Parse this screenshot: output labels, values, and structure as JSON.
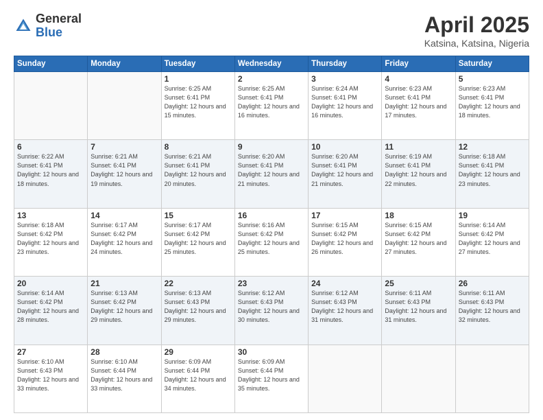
{
  "logo": {
    "general": "General",
    "blue": "Blue"
  },
  "title": {
    "month": "April 2025",
    "location": "Katsina, Katsina, Nigeria"
  },
  "weekdays": [
    "Sunday",
    "Monday",
    "Tuesday",
    "Wednesday",
    "Thursday",
    "Friday",
    "Saturday"
  ],
  "weeks": [
    [
      {
        "day": "",
        "sunrise": "",
        "sunset": "",
        "daylight": ""
      },
      {
        "day": "",
        "sunrise": "",
        "sunset": "",
        "daylight": ""
      },
      {
        "day": "1",
        "sunrise": "Sunrise: 6:25 AM",
        "sunset": "Sunset: 6:41 PM",
        "daylight": "Daylight: 12 hours and 15 minutes."
      },
      {
        "day": "2",
        "sunrise": "Sunrise: 6:25 AM",
        "sunset": "Sunset: 6:41 PM",
        "daylight": "Daylight: 12 hours and 16 minutes."
      },
      {
        "day": "3",
        "sunrise": "Sunrise: 6:24 AM",
        "sunset": "Sunset: 6:41 PM",
        "daylight": "Daylight: 12 hours and 16 minutes."
      },
      {
        "day": "4",
        "sunrise": "Sunrise: 6:23 AM",
        "sunset": "Sunset: 6:41 PM",
        "daylight": "Daylight: 12 hours and 17 minutes."
      },
      {
        "day": "5",
        "sunrise": "Sunrise: 6:23 AM",
        "sunset": "Sunset: 6:41 PM",
        "daylight": "Daylight: 12 hours and 18 minutes."
      }
    ],
    [
      {
        "day": "6",
        "sunrise": "Sunrise: 6:22 AM",
        "sunset": "Sunset: 6:41 PM",
        "daylight": "Daylight: 12 hours and 18 minutes."
      },
      {
        "day": "7",
        "sunrise": "Sunrise: 6:21 AM",
        "sunset": "Sunset: 6:41 PM",
        "daylight": "Daylight: 12 hours and 19 minutes."
      },
      {
        "day": "8",
        "sunrise": "Sunrise: 6:21 AM",
        "sunset": "Sunset: 6:41 PM",
        "daylight": "Daylight: 12 hours and 20 minutes."
      },
      {
        "day": "9",
        "sunrise": "Sunrise: 6:20 AM",
        "sunset": "Sunset: 6:41 PM",
        "daylight": "Daylight: 12 hours and 21 minutes."
      },
      {
        "day": "10",
        "sunrise": "Sunrise: 6:20 AM",
        "sunset": "Sunset: 6:41 PM",
        "daylight": "Daylight: 12 hours and 21 minutes."
      },
      {
        "day": "11",
        "sunrise": "Sunrise: 6:19 AM",
        "sunset": "Sunset: 6:41 PM",
        "daylight": "Daylight: 12 hours and 22 minutes."
      },
      {
        "day": "12",
        "sunrise": "Sunrise: 6:18 AM",
        "sunset": "Sunset: 6:41 PM",
        "daylight": "Daylight: 12 hours and 23 minutes."
      }
    ],
    [
      {
        "day": "13",
        "sunrise": "Sunrise: 6:18 AM",
        "sunset": "Sunset: 6:42 PM",
        "daylight": "Daylight: 12 hours and 23 minutes."
      },
      {
        "day": "14",
        "sunrise": "Sunrise: 6:17 AM",
        "sunset": "Sunset: 6:42 PM",
        "daylight": "Daylight: 12 hours and 24 minutes."
      },
      {
        "day": "15",
        "sunrise": "Sunrise: 6:17 AM",
        "sunset": "Sunset: 6:42 PM",
        "daylight": "Daylight: 12 hours and 25 minutes."
      },
      {
        "day": "16",
        "sunrise": "Sunrise: 6:16 AM",
        "sunset": "Sunset: 6:42 PM",
        "daylight": "Daylight: 12 hours and 25 minutes."
      },
      {
        "day": "17",
        "sunrise": "Sunrise: 6:15 AM",
        "sunset": "Sunset: 6:42 PM",
        "daylight": "Daylight: 12 hours and 26 minutes."
      },
      {
        "day": "18",
        "sunrise": "Sunrise: 6:15 AM",
        "sunset": "Sunset: 6:42 PM",
        "daylight": "Daylight: 12 hours and 27 minutes."
      },
      {
        "day": "19",
        "sunrise": "Sunrise: 6:14 AM",
        "sunset": "Sunset: 6:42 PM",
        "daylight": "Daylight: 12 hours and 27 minutes."
      }
    ],
    [
      {
        "day": "20",
        "sunrise": "Sunrise: 6:14 AM",
        "sunset": "Sunset: 6:42 PM",
        "daylight": "Daylight: 12 hours and 28 minutes."
      },
      {
        "day": "21",
        "sunrise": "Sunrise: 6:13 AM",
        "sunset": "Sunset: 6:42 PM",
        "daylight": "Daylight: 12 hours and 29 minutes."
      },
      {
        "day": "22",
        "sunrise": "Sunrise: 6:13 AM",
        "sunset": "Sunset: 6:43 PM",
        "daylight": "Daylight: 12 hours and 29 minutes."
      },
      {
        "day": "23",
        "sunrise": "Sunrise: 6:12 AM",
        "sunset": "Sunset: 6:43 PM",
        "daylight": "Daylight: 12 hours and 30 minutes."
      },
      {
        "day": "24",
        "sunrise": "Sunrise: 6:12 AM",
        "sunset": "Sunset: 6:43 PM",
        "daylight": "Daylight: 12 hours and 31 minutes."
      },
      {
        "day": "25",
        "sunrise": "Sunrise: 6:11 AM",
        "sunset": "Sunset: 6:43 PM",
        "daylight": "Daylight: 12 hours and 31 minutes."
      },
      {
        "day": "26",
        "sunrise": "Sunrise: 6:11 AM",
        "sunset": "Sunset: 6:43 PM",
        "daylight": "Daylight: 12 hours and 32 minutes."
      }
    ],
    [
      {
        "day": "27",
        "sunrise": "Sunrise: 6:10 AM",
        "sunset": "Sunset: 6:43 PM",
        "daylight": "Daylight: 12 hours and 33 minutes."
      },
      {
        "day": "28",
        "sunrise": "Sunrise: 6:10 AM",
        "sunset": "Sunset: 6:44 PM",
        "daylight": "Daylight: 12 hours and 33 minutes."
      },
      {
        "day": "29",
        "sunrise": "Sunrise: 6:09 AM",
        "sunset": "Sunset: 6:44 PM",
        "daylight": "Daylight: 12 hours and 34 minutes."
      },
      {
        "day": "30",
        "sunrise": "Sunrise: 6:09 AM",
        "sunset": "Sunset: 6:44 PM",
        "daylight": "Daylight: 12 hours and 35 minutes."
      },
      {
        "day": "",
        "sunrise": "",
        "sunset": "",
        "daylight": ""
      },
      {
        "day": "",
        "sunrise": "",
        "sunset": "",
        "daylight": ""
      },
      {
        "day": "",
        "sunrise": "",
        "sunset": "",
        "daylight": ""
      }
    ]
  ]
}
